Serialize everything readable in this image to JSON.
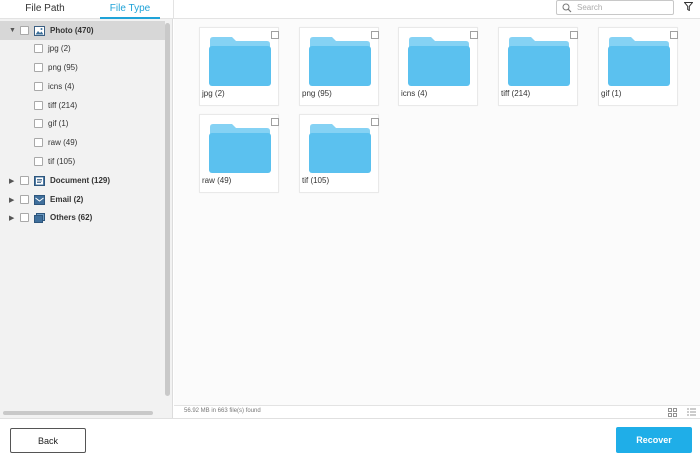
{
  "tabs": {
    "file_path": "File Path",
    "file_type": "File Type"
  },
  "search": {
    "placeholder": "Search",
    "value": ""
  },
  "sidebar": {
    "categories": [
      {
        "name": "Photo (470)",
        "icon": "photo-icon",
        "expanded": true,
        "selected": true,
        "children": [
          "jpg (2)",
          "png (95)",
          "icns (4)",
          "tiff (214)",
          "gif (1)",
          "raw (49)",
          "tif (105)"
        ]
      },
      {
        "name": "Document (129)",
        "icon": "document-icon",
        "expanded": false
      },
      {
        "name": "Email (2)",
        "icon": "email-icon",
        "expanded": false
      },
      {
        "name": "Others (62)",
        "icon": "others-icon",
        "expanded": false
      }
    ]
  },
  "grid": {
    "items": [
      "jpg (2)",
      "png (95)",
      "icns (4)",
      "tiff (214)",
      "gif (1)",
      "raw (49)",
      "tif (105)"
    ]
  },
  "status": {
    "text": "56.92 MB in 663 file(s) found"
  },
  "buttons": {
    "back": "Back",
    "recover": "Recover"
  },
  "colors": {
    "accent": "#1faee8",
    "folder": "#5bc1ef",
    "folder_tab": "#85d2f4",
    "sidebar_bg": "#f2f2f2",
    "selected_row": "#d7d7d7"
  }
}
